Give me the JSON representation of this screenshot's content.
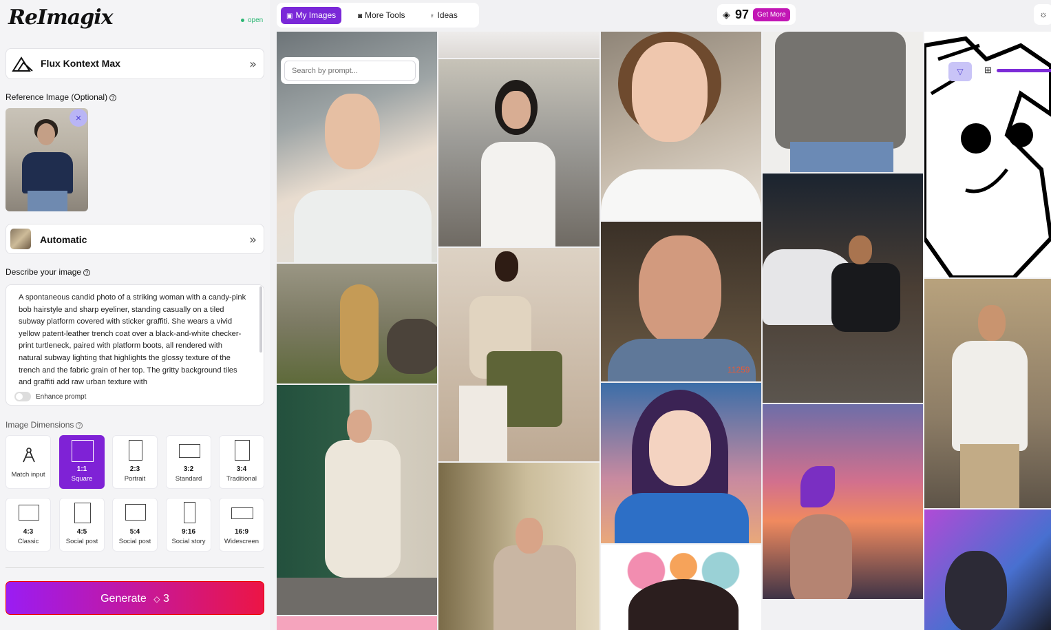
{
  "app": {
    "logo": "ReImagix",
    "status": "open"
  },
  "model": {
    "name": "Flux Kontext Max",
    "chevron": "»"
  },
  "reference": {
    "label": "Reference Image (Optional)",
    "close": "×"
  },
  "style": {
    "name": "Automatic",
    "chevron": "»"
  },
  "describe": {
    "label": "Describe your image",
    "prompt": "A spontaneous candid photo of a striking woman with a candy-pink bob hairstyle and sharp eyeliner, standing casually on a tiled subway platform covered with sticker graffiti. She wears a vivid yellow patent-leather trench coat over a black-and-white checker-print turtleneck, paired with platform boots, all rendered with natural subway lighting that highlights the glossy texture of the trench and the fabric grain of her top. The gritty background tiles and graffiti add raw urban texture with",
    "enhance": "Enhance prompt"
  },
  "dimensions": {
    "label": "Image Dimensions",
    "options": [
      {
        "ratio": "",
        "name": "Match input"
      },
      {
        "ratio": "1:1",
        "name": "Square"
      },
      {
        "ratio": "2:3",
        "name": "Portrait"
      },
      {
        "ratio": "3:2",
        "name": "Standard"
      },
      {
        "ratio": "3:4",
        "name": "Traditional"
      },
      {
        "ratio": "4:3",
        "name": "Classic"
      },
      {
        "ratio": "4:5",
        "name": "Social post"
      },
      {
        "ratio": "5:4",
        "name": "Social post"
      },
      {
        "ratio": "9:16",
        "name": "Social story"
      },
      {
        "ratio": "16:9",
        "name": "Widescreen"
      }
    ],
    "selected": "1:1"
  },
  "generate": {
    "label": "Generate",
    "cost": "3"
  },
  "nav": {
    "tabs": [
      "My Images",
      "More Tools",
      "Ideas"
    ],
    "active": "My Images"
  },
  "credits": {
    "count": "97",
    "get_more": "Get More"
  },
  "search": {
    "placeholder": "Search by prompt..."
  },
  "gallery": {
    "tag_number": "11259"
  },
  "icons": {
    "model": "triangle-logo-icon",
    "help": "help-circle-icon",
    "gem": "gem-icon",
    "settings": "sun-icon",
    "filter": "filter-icon",
    "grid": "grid-icon"
  },
  "colors": {
    "accent": "#7a28d8",
    "generate_start": "#9a1cf3",
    "generate_end": "#ec1545",
    "get_more": "#c216b5",
    "status": "#2bb673"
  }
}
